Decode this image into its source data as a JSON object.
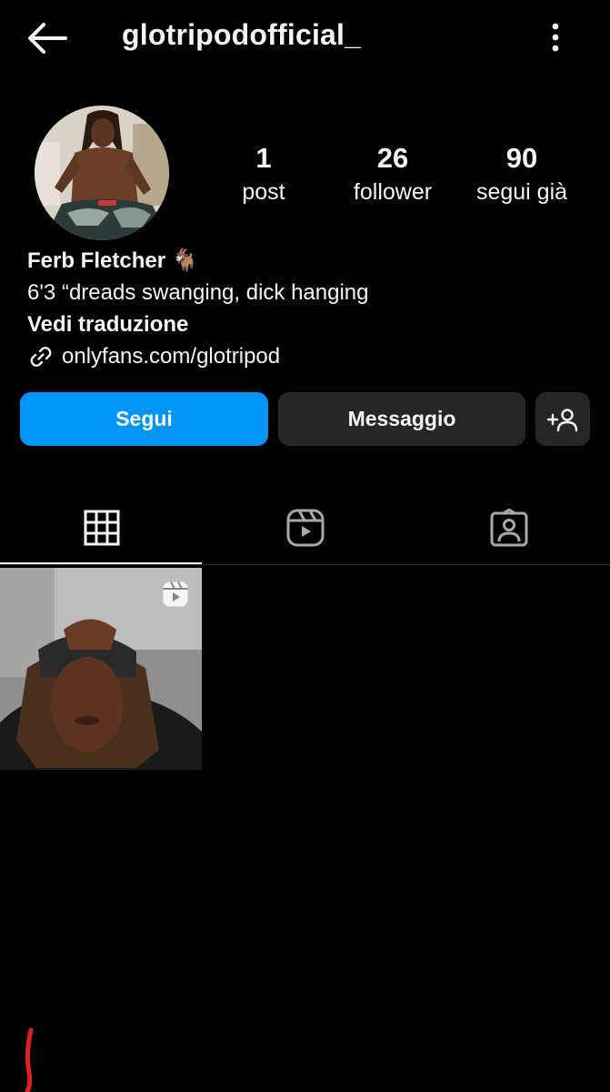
{
  "header": {
    "username": "glotripodofficial_",
    "back_icon": "arrow-left-icon",
    "more_icon": "more-vertical-icon"
  },
  "profile": {
    "stats": [
      {
        "value": "1",
        "label": "post"
      },
      {
        "value": "26",
        "label": "follower"
      },
      {
        "value": "90",
        "label": "segui già"
      }
    ],
    "name": "Ferb Fletcher 🐐",
    "bio": "6'3 “dreads swanging, dick hanging",
    "translate_label": "Vedi traduzione",
    "link": "onlyfans.com/glotripod"
  },
  "actions": {
    "follow_label": "Segui",
    "message_label": "Messaggio",
    "suggest_icon": "add-person-icon"
  },
  "tabs": [
    {
      "icon": "grid-icon",
      "selected": true
    },
    {
      "icon": "reels-icon",
      "selected": false
    },
    {
      "icon": "tagged-icon",
      "selected": false
    }
  ],
  "posts": [
    {
      "type": "reel",
      "badge_icon": "reel-badge-icon"
    }
  ],
  "colors": {
    "background": "#000000",
    "accent": "#0095f6",
    "secondary_button": "#262626",
    "text": "#f5f5f5"
  }
}
